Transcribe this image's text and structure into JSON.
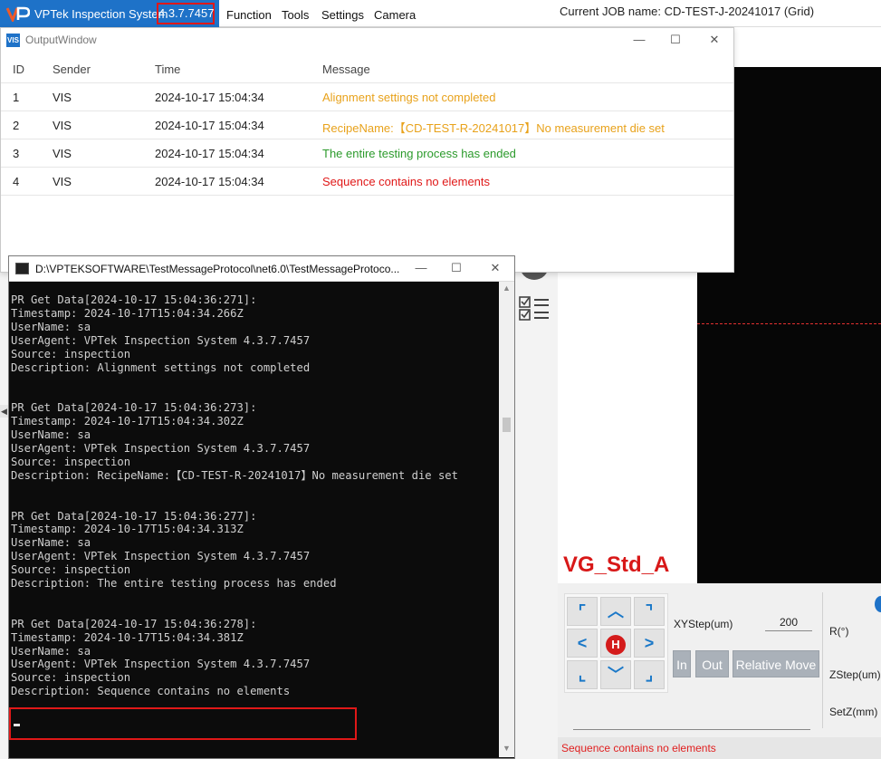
{
  "app": {
    "title": "VPTek Inspection System",
    "version": "4.3.7.7457",
    "menu": [
      "Function",
      "Tools",
      "Settings",
      "Camera"
    ],
    "current_job": "Current JOB name:  CD-TEST-J-20241017 (Grid)",
    "recipe_name": "VG_Std_A",
    "status_message": "Sequence contains no elements",
    "colors": {
      "brand": "#1e72c8",
      "alert": "#e01818"
    }
  },
  "motion": {
    "xystep_label": "XYStep(um)",
    "xystep_value": "200",
    "r_label": "R(°)",
    "zstep_label": "ZStep(um)",
    "setz_label": "SetZ(mm)",
    "in_label": "In",
    "out_label": "Out",
    "relative_move_label": "Relative Move",
    "home_label": "H"
  },
  "output_window": {
    "title": "OutputWindow",
    "icon_text": "VIS",
    "columns": [
      "ID",
      "Sender",
      "Time",
      "Message"
    ],
    "rows": [
      {
        "id": "1",
        "sender": "VIS",
        "time": "2024-10-17 15:04:34",
        "message": "Alignment settings not completed",
        "color": "#e8a21b"
      },
      {
        "id": "2",
        "sender": "VIS",
        "time": "2024-10-17 15:04:34",
        "message": "RecipeName:【CD-TEST-R-20241017】No measurement die set",
        "color": "#e8a21b"
      },
      {
        "id": "3",
        "sender": "VIS",
        "time": "2024-10-17 15:04:34",
        "message": "The entire testing process has ended",
        "color": "#2b9a2b"
      },
      {
        "id": "4",
        "sender": "VIS",
        "time": "2024-10-17 15:04:34",
        "message": "Sequence contains no elements",
        "color": "#e01818"
      }
    ]
  },
  "console": {
    "title": "D:\\VPTEKSOFTWARE\\TestMessageProtocol\\net6.0\\TestMessageProtoco...",
    "lines": [
      "PR Get Data[2024-10-17 15:04:36:271]:",
      "Timestamp: 2024-10-17T15:04:34.266Z",
      "UserName: sa",
      "UserAgent: VPTek Inspection System 4.3.7.7457",
      "Source: inspection",
      "Description: Alignment settings not completed",
      "",
      "",
      "PR Get Data[2024-10-17 15:04:36:273]:",
      "Timestamp: 2024-10-17T15:04:34.302Z",
      "UserName: sa",
      "UserAgent: VPTek Inspection System 4.3.7.7457",
      "Source: inspection",
      "Description: RecipeName:【CD-TEST-R-20241017】No measurement die set",
      "",
      "",
      "PR Get Data[2024-10-17 15:04:36:277]:",
      "Timestamp: 2024-10-17T15:04:34.313Z",
      "UserName: sa",
      "UserAgent: VPTek Inspection System 4.3.7.7457",
      "Source: inspection",
      "Description: The entire testing process has ended",
      "",
      "",
      "PR Get Data[2024-10-17 15:04:36:278]:",
      "Timestamp: 2024-10-17T15:04:34.381Z",
      "UserName: sa",
      "UserAgent: VPTek Inspection System 4.3.7.7457",
      "Source: inspection",
      "Description: Sequence contains no elements"
    ]
  }
}
